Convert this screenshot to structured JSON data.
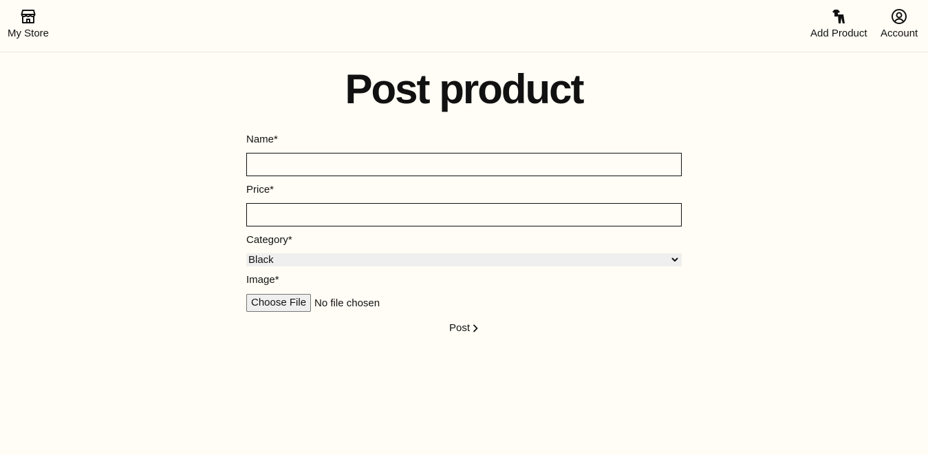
{
  "nav": {
    "store_label": "My Store",
    "add_product_label": "Add Product",
    "account_label": "Account"
  },
  "page": {
    "title": "Post product"
  },
  "form": {
    "name_label": "Name*",
    "name_value": "",
    "price_label": "Price*",
    "price_value": "",
    "category_label": "Category*",
    "category_value": "Black",
    "image_label": "Image*",
    "file_button_label": "Choose File",
    "file_status": "No file chosen",
    "submit_label": "Post"
  },
  "icons": {
    "store": "store-icon",
    "add_product": "clothing-icon",
    "account": "user-circle-icon",
    "select": "chevron-down-icon",
    "submit": "chevron-right-icon"
  },
  "colors": {
    "background": "#fffdf5",
    "text": "#111111",
    "select_background": "#efefef"
  }
}
